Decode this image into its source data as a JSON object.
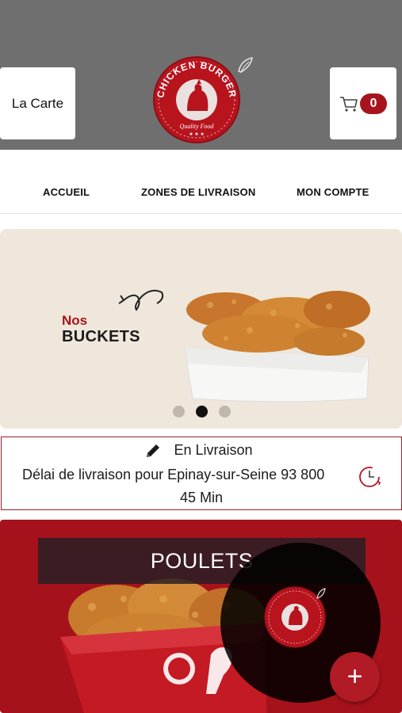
{
  "header": {
    "menu_label": "La Carte",
    "cart_count": "0",
    "logo_text_top": "CHICKEN BURGER",
    "logo_text_bottom": "Quality Food"
  },
  "nav": {
    "items": [
      {
        "label": "ACCUEIL"
      },
      {
        "label": "ZONES DE LIVRAISON"
      },
      {
        "label": "MON COMPTE"
      }
    ]
  },
  "banner": {
    "title_small": "Nos",
    "title_big": "BUCKETS",
    "slides_total": 3,
    "active_slide": 2
  },
  "delivery": {
    "mode": "En Livraison",
    "delay_text": "Délai de livraison pour Epinay-sur-Seine 93 800",
    "time": "45 Min"
  },
  "category": {
    "label": "POULETS"
  },
  "fab": {
    "label": "+"
  },
  "colors": {
    "brand_red": "#a8141c",
    "header_gray": "#6f6f6f",
    "banner_bg": "#efe7db"
  },
  "icons": {
    "cart": "cart-icon",
    "pencil": "pencil-icon",
    "clock": "clock-icon",
    "plus": "plus-icon"
  }
}
